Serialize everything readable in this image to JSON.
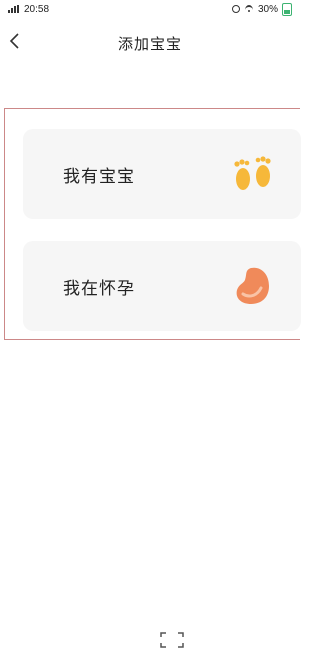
{
  "status_bar": {
    "time": "20:58",
    "battery": "30%"
  },
  "header": {
    "title": "添加宝宝"
  },
  "options": [
    {
      "label": "我有宝宝",
      "icon": "baby-feet-icon"
    },
    {
      "label": "我在怀孕",
      "icon": "pregnancy-icon"
    }
  ],
  "colors": {
    "feet": "#f6b83a",
    "pregnancy": "#f08a5a",
    "card_bg": "#f6f6f6"
  }
}
